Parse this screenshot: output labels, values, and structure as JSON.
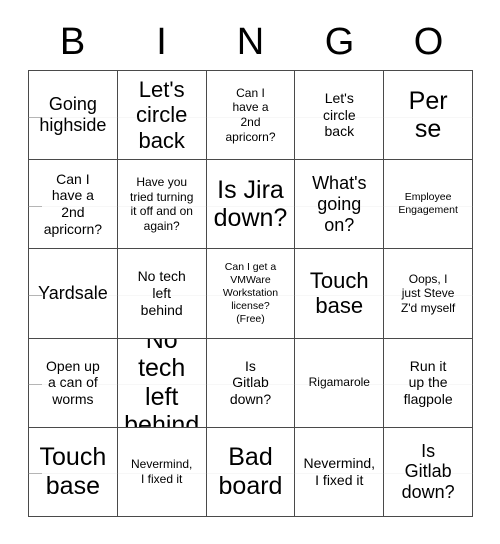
{
  "header": {
    "letters": [
      "B",
      "I",
      "N",
      "G",
      "O"
    ]
  },
  "grid": {
    "rows": [
      [
        {
          "text": "Going\nhighside",
          "size": "md"
        },
        {
          "text": "Let's\ncircle\nback",
          "size": "lg"
        },
        {
          "text": "Can I\nhave a\n2nd\napricorn?",
          "size": "xs"
        },
        {
          "text": "Let's\ncircle\nback",
          "size": "sm"
        },
        {
          "text": "Per\nse",
          "size": "xl"
        }
      ],
      [
        {
          "text": "Can I\nhave a\n2nd\napricorn?",
          "size": "sm"
        },
        {
          "text": "Have you\ntried turning\nit off and on\nagain?",
          "size": "xs"
        },
        {
          "text": "Is Jira\ndown?",
          "size": "xl"
        },
        {
          "text": "What's\ngoing\non?",
          "size": "md"
        },
        {
          "text": "Employee\nEngagement",
          "size": "xxs"
        }
      ],
      [
        {
          "text": "Yardsale",
          "size": "md"
        },
        {
          "text": "No tech\nleft\nbehind",
          "size": "sm"
        },
        {
          "text": "Can I get a\nVMWare\nWorkstation\nlicense?\n(Free)",
          "size": "xxs"
        },
        {
          "text": "Touch\nbase",
          "size": "lg"
        },
        {
          "text": "Oops, I\njust Steve\nZ'd myself",
          "size": "xs"
        }
      ],
      [
        {
          "text": "Open up\na can of\nworms",
          "size": "sm"
        },
        {
          "text": "No tech\nleft\nbehind",
          "size": "xl"
        },
        {
          "text": "Is\nGitlab\ndown?",
          "size": "sm"
        },
        {
          "text": "Rigamarole",
          "size": "xs"
        },
        {
          "text": "Run it\nup the\nflagpole",
          "size": "sm"
        }
      ],
      [
        {
          "text": "Touch\nbase",
          "size": "xl"
        },
        {
          "text": "Nevermind,\nI fixed it",
          "size": "xs"
        },
        {
          "text": "Bad\nboard",
          "size": "xl"
        },
        {
          "text": "Nevermind,\nI fixed it",
          "size": "sm"
        },
        {
          "text": "Is\nGitlab\ndown?",
          "size": "md"
        }
      ]
    ]
  },
  "colors": {
    "grid_line": "#4a4a4a",
    "text": "#000000",
    "background": "#ffffff"
  }
}
